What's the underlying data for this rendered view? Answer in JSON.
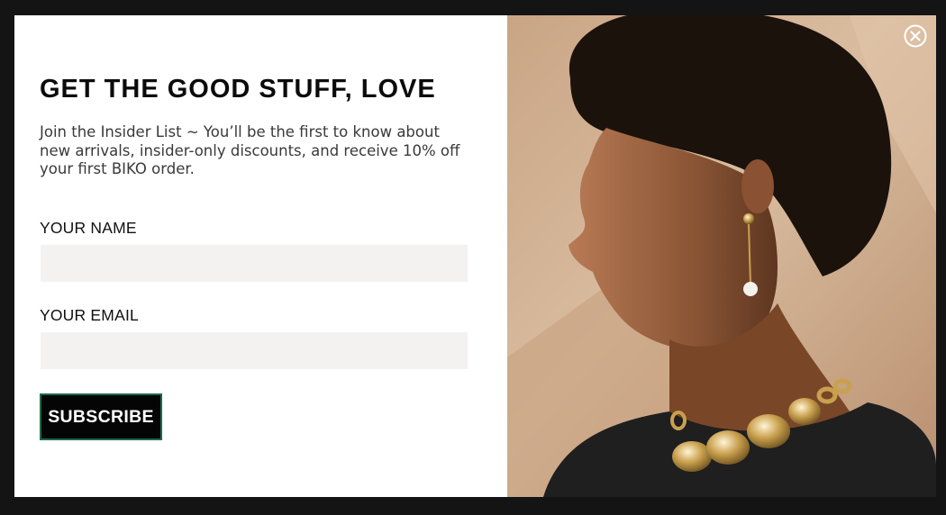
{
  "popup": {
    "title": "GET THE GOOD STUFF, LOVE",
    "description": "Join the Insider List ~ You’ll be the first to know about new arrivals, insider-only discounts, and receive 10% off your first BIKO order.",
    "name_label": "YOUR NAME",
    "name_value": "",
    "email_label": "YOUR EMAIL",
    "email_value": "",
    "subscribe_label": "SUBSCRIBE"
  },
  "image": {
    "description_icon": "model-portrait-photo"
  },
  "colors": {
    "overlay": "#141414",
    "modal_bg": "#ffffff",
    "field_bg": "#f3f2f0",
    "button_bg": "#050505",
    "button_border": "#1f6a4a"
  },
  "icons": {
    "close": "close-circle-icon"
  }
}
